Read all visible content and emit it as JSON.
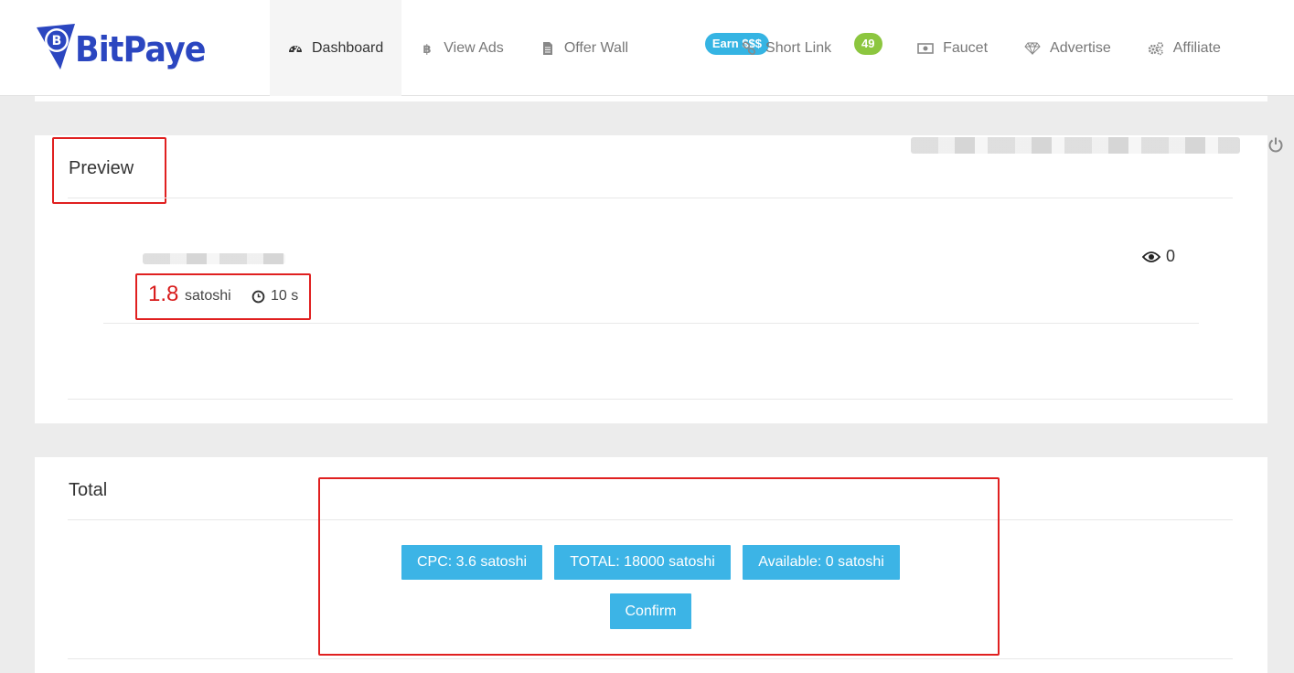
{
  "brand": {
    "name": "BitPaye",
    "color": "#2b46c0"
  },
  "nav": {
    "items": [
      {
        "label": "Dashboard",
        "icon": "dashboard-icon",
        "active": true
      },
      {
        "label": "View Ads",
        "icon": "bitcoin-icon"
      },
      {
        "label": "Offer Wall",
        "icon": "document-icon",
        "badge": "Earn $$$"
      },
      {
        "label": "Short Link",
        "icon": "link-icon",
        "badge": "49"
      },
      {
        "label": "Faucet",
        "icon": "money-icon"
      },
      {
        "label": "Advertise",
        "icon": "diamond-icon"
      },
      {
        "label": "Affiliate",
        "icon": "gears-icon"
      }
    ]
  },
  "preview": {
    "title": "Preview",
    "reward_value": "1.8",
    "reward_unit": "satoshi",
    "timer": "10 s",
    "views": "0"
  },
  "total": {
    "title": "Total",
    "cpc": "CPC: 3.6 satoshi",
    "total": "TOTAL: 18000 satoshi",
    "available": "Available: 0 satoshi",
    "confirm": "Confirm"
  },
  "colors": {
    "accent": "#3cb4e6",
    "reward": "#d81b1b",
    "highlight_border": "#e02020",
    "badge_green": "#8cc63f"
  }
}
